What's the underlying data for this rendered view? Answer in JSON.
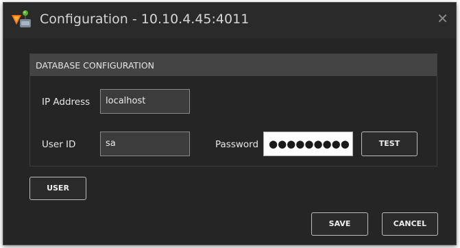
{
  "window": {
    "title": "Configuration - 10.10.4.45:4011",
    "close_glyph": "✕",
    "icon": "app-logo-icon"
  },
  "database": {
    "section_title": "DATABASE CONFIGURATION",
    "ip_label": "IP Address",
    "ip_value": "localhost",
    "userid_label": "User ID",
    "userid_value": "sa",
    "password_label": "Password",
    "password_mask": "●●●●●●●●●",
    "test_button": "TEST"
  },
  "buttons": {
    "user": "USER",
    "save": "SAVE",
    "cancel": "CANCEL"
  },
  "colors": {
    "background": "#252525",
    "panel_header": "#444444",
    "field": "#3c3c3c"
  }
}
